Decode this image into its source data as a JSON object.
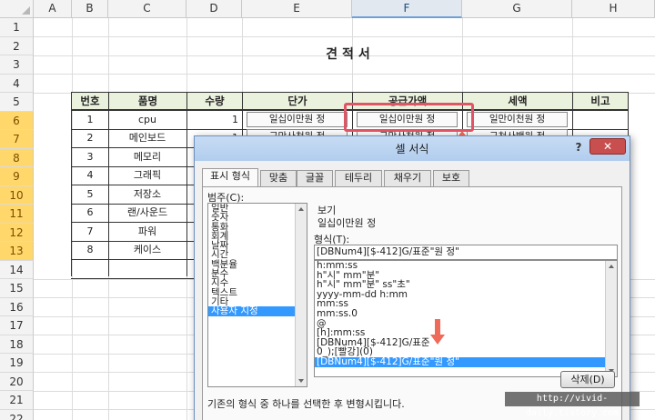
{
  "columns": [
    "A",
    "B",
    "C",
    "D",
    "E",
    "F",
    "G",
    "H"
  ],
  "rows": [
    "1",
    "2",
    "3",
    "4",
    "5",
    "6",
    "7",
    "8",
    "9",
    "10",
    "11",
    "12",
    "13",
    "14",
    "15",
    "16",
    "17",
    "18",
    "19",
    "20",
    "21",
    "22"
  ],
  "sheet_title": "견적서",
  "table": {
    "headers": [
      "번호",
      "품명",
      "수량",
      "단가",
      "공급가액",
      "세액",
      "비고"
    ],
    "rows": [
      {
        "no": "1",
        "item": "cpu",
        "qty": "1",
        "price": "일십이만원 정",
        "supply": "일십이만원 정",
        "tax": "일만이천원 정"
      },
      {
        "no": "2",
        "item": "메인보드",
        "qty": "1",
        "price": "구만사천원 정",
        "supply": "구만사천원 정",
        "tax": "구천사백원 정"
      },
      {
        "no": "3",
        "item": "메모리"
      },
      {
        "no": "4",
        "item": "그래픽"
      },
      {
        "no": "5",
        "item": "저장소"
      },
      {
        "no": "6",
        "item": "랜/사운드"
      },
      {
        "no": "7",
        "item": "파워"
      },
      {
        "no": "8",
        "item": "케이스"
      }
    ]
  },
  "dialog": {
    "title": "셀 서식",
    "help": "?",
    "close": "✕",
    "tabs": [
      "표시 형식",
      "맞춤",
      "글꼴",
      "테두리",
      "채우기",
      "보호"
    ],
    "category_label": "범주(C):",
    "categories": [
      "일반",
      "숫자",
      "통화",
      "회계",
      "날짜",
      "시간",
      "백분율",
      "분수",
      "지수",
      "텍스트",
      "기타",
      "사용자 지정"
    ],
    "preview_label": "보기",
    "preview_value": "일십이만원 정",
    "format_label": "형식(T):",
    "format_value": "[DBNum4][$-412]G/표준\"원 정\"",
    "format_list": [
      "h:mm:ss",
      "h\"시\" mm\"분\"",
      "h\"시\" mm\"분\" ss\"초\"",
      "yyyy-mm-dd h:mm",
      "mm:ss",
      "mm:ss.0",
      "@",
      "[h]:mm:ss",
      "[DBNum4][$-412]G/표준",
      "0_);[빨강](0)",
      "[DBNum4][$-412]G/표준\"원 정\""
    ],
    "delete_button": "삭제(D)",
    "description": "기존의 형식 중 하나를 선택한 후 변형시킵니다."
  },
  "watermark": "http://vivid-daily.tistory.com",
  "colors": {
    "header_fill": "#eaf1dd",
    "highlight": "#e05566",
    "selection": "#3399ff"
  }
}
